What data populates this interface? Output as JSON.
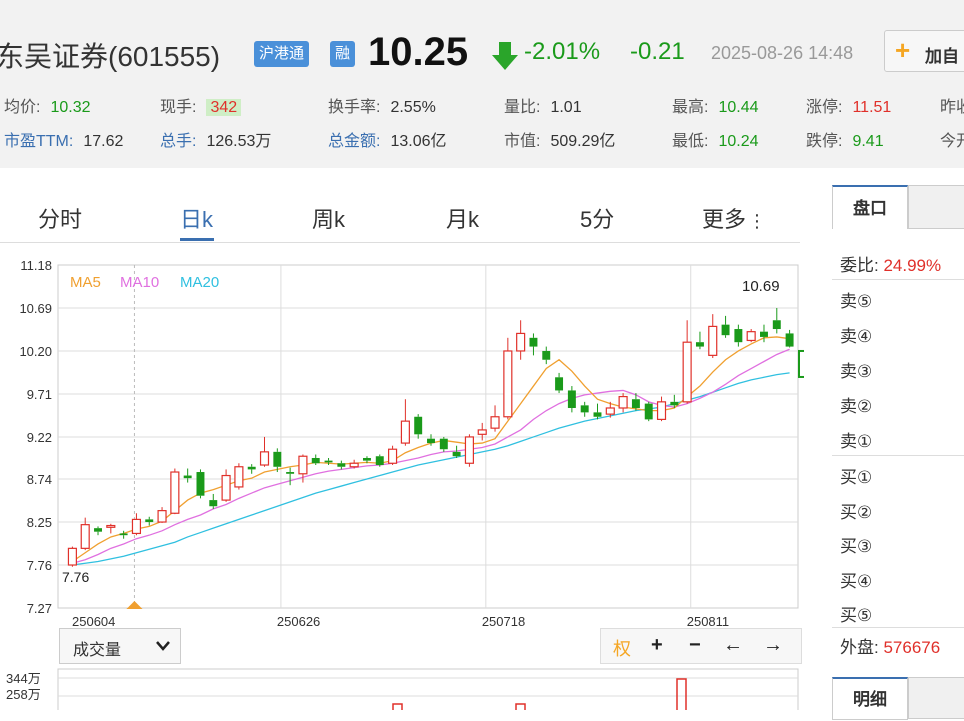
{
  "header": {
    "stock_name": "东吴证券(601555)",
    "badge_hk": "沪港通",
    "badge_margin": "融",
    "price": "10.25",
    "change_pct": "-2.01%",
    "change_abs": "-0.21",
    "datetime": "2025-08-26 14:48",
    "add_button": "加自",
    "stats_row1": [
      {
        "label": "均价:",
        "value": "10.32",
        "color": "g"
      },
      {
        "label": "现手:",
        "value": "342",
        "color": "hl"
      },
      {
        "label": "换手率:",
        "value": "2.55%",
        "color": ""
      },
      {
        "label": "量比:",
        "value": "1.01",
        "color": ""
      },
      {
        "label": "最高:",
        "value": "10.44",
        "color": "g"
      },
      {
        "label": "涨停:",
        "value": "11.51",
        "color": "r"
      },
      {
        "label": "昨收",
        "value": "",
        "color": ""
      }
    ],
    "stats_row2": [
      {
        "label": "市盈TTM:",
        "value": "17.62",
        "color": ""
      },
      {
        "label": "总手:",
        "value": "126.53万",
        "color": ""
      },
      {
        "label": "总金额:",
        "value": "13.06亿",
        "color": ""
      },
      {
        "label": "市值:",
        "value": "509.29亿",
        "color": ""
      },
      {
        "label": "最低:",
        "value": "10.24",
        "color": "g"
      },
      {
        "label": "跌停:",
        "value": "9.41",
        "color": "g"
      },
      {
        "label": "今开",
        "value": "",
        "color": ""
      }
    ]
  },
  "tabs": [
    "分时",
    "日k",
    "周k",
    "月k",
    "5分",
    "更多"
  ],
  "active_tab": "日k",
  "chart_data": {
    "type": "candlestick",
    "legend": [
      "MA5",
      "MA10",
      "MA20"
    ],
    "legend_colors": [
      "#f0a030",
      "#e070e0",
      "#30c0e0"
    ],
    "y_ticks": [
      "11.18",
      "10.69",
      "10.20",
      "9.71",
      "9.22",
      "8.74",
      "8.25",
      "7.76",
      "7.27"
    ],
    "ylim": [
      7.27,
      11.18
    ],
    "x_ticks": [
      {
        "label": "250604",
        "index": 0
      },
      {
        "label": "250626",
        "index": 16
      },
      {
        "label": "250718",
        "index": 32
      },
      {
        "label": "250811",
        "index": 48
      }
    ],
    "max_label": "10.69",
    "min_label": "7.76",
    "candles": [
      [
        7.76,
        7.95,
        7.74,
        7.97
      ],
      [
        7.95,
        8.22,
        7.93,
        8.3
      ],
      [
        8.18,
        8.14,
        8.1,
        8.2
      ],
      [
        8.19,
        8.21,
        8.12,
        8.23
      ],
      [
        8.12,
        8.1,
        8.06,
        8.15
      ],
      [
        8.12,
        8.28,
        8.1,
        8.35
      ],
      [
        8.28,
        8.25,
        8.21,
        8.31
      ],
      [
        8.25,
        8.38,
        8.24,
        8.42
      ],
      [
        8.35,
        8.82,
        8.34,
        8.86
      ],
      [
        8.78,
        8.75,
        8.7,
        8.86
      ],
      [
        8.82,
        8.55,
        8.52,
        8.85
      ],
      [
        8.5,
        8.43,
        8.4,
        8.57
      ],
      [
        8.5,
        8.78,
        8.48,
        8.85
      ],
      [
        8.65,
        8.88,
        8.62,
        8.92
      ],
      [
        8.88,
        8.85,
        8.8,
        8.91
      ],
      [
        8.9,
        9.05,
        8.88,
        9.22
      ],
      [
        9.05,
        8.88,
        8.82,
        9.09
      ],
      [
        8.82,
        8.8,
        8.67,
        8.87
      ],
      [
        8.8,
        9.0,
        8.7,
        9.02
      ],
      [
        8.98,
        8.92,
        8.9,
        9.02
      ],
      [
        8.95,
        8.93,
        8.9,
        8.98
      ],
      [
        8.92,
        8.88,
        8.85,
        8.95
      ],
      [
        8.88,
        8.92,
        8.86,
        8.96
      ],
      [
        8.98,
        8.95,
        8.92,
        9.0
      ],
      [
        9.0,
        8.9,
        8.88,
        9.02
      ],
      [
        8.92,
        9.08,
        8.9,
        9.12
      ],
      [
        9.15,
        9.4,
        9.12,
        9.65
      ],
      [
        9.45,
        9.25,
        9.2,
        9.48
      ],
      [
        9.2,
        9.15,
        9.12,
        9.25
      ],
      [
        9.2,
        9.08,
        9.05,
        9.22
      ],
      [
        9.05,
        9.0,
        8.98,
        9.12
      ],
      [
        8.92,
        9.22,
        8.88,
        9.25
      ],
      [
        9.25,
        9.3,
        9.18,
        9.38
      ],
      [
        9.32,
        9.45,
        9.28,
        9.58
      ],
      [
        9.45,
        10.2,
        9.42,
        10.35
      ],
      [
        10.2,
        10.4,
        10.1,
        10.55
      ],
      [
        10.35,
        10.25,
        10.15,
        10.4
      ],
      [
        10.2,
        10.1,
        10.05,
        10.25
      ],
      [
        9.9,
        9.75,
        9.72,
        9.95
      ],
      [
        9.75,
        9.55,
        9.5,
        9.8
      ],
      [
        9.58,
        9.5,
        9.45,
        9.62
      ],
      [
        9.5,
        9.45,
        9.42,
        9.6
      ],
      [
        9.48,
        9.55,
        9.44,
        9.62
      ],
      [
        9.55,
        9.68,
        9.5,
        9.72
      ],
      [
        9.65,
        9.55,
        9.52,
        9.72
      ],
      [
        9.6,
        9.42,
        9.4,
        9.62
      ],
      [
        9.42,
        9.62,
        9.4,
        9.68
      ],
      [
        9.62,
        9.58,
        9.55,
        9.7
      ],
      [
        9.62,
        10.3,
        9.6,
        10.55
      ],
      [
        10.3,
        10.25,
        10.22,
        10.42
      ],
      [
        10.15,
        10.48,
        10.12,
        10.62
      ],
      [
        10.5,
        10.38,
        10.35,
        10.6
      ],
      [
        10.45,
        10.3,
        10.25,
        10.5
      ],
      [
        10.32,
        10.42,
        10.3,
        10.45
      ],
      [
        10.42,
        10.36,
        10.3,
        10.5
      ],
      [
        10.55,
        10.45,
        10.4,
        10.69
      ],
      [
        10.4,
        10.25,
        10.24,
        10.44
      ]
    ],
    "ma5": [
      7.8,
      7.9,
      8.0,
      8.08,
      8.12,
      8.17,
      8.2,
      8.26,
      8.38,
      8.5,
      8.58,
      8.62,
      8.67,
      8.72,
      8.75,
      8.82,
      8.85,
      8.88,
      8.9,
      8.93,
      8.92,
      8.91,
      8.92,
      8.93,
      8.92,
      8.95,
      9.04,
      9.1,
      9.15,
      9.18,
      9.16,
      9.14,
      9.15,
      9.2,
      9.4,
      9.6,
      9.8,
      10.0,
      10.1,
      9.97,
      9.8,
      9.65,
      9.6,
      9.56,
      9.54,
      9.52,
      9.52,
      9.55,
      9.68,
      9.8,
      9.96,
      10.1,
      10.2,
      10.28,
      10.35,
      10.36,
      10.34
    ],
    "ma10": [
      7.78,
      7.82,
      7.88,
      7.95,
      8.0,
      8.06,
      8.1,
      8.15,
      8.22,
      8.28,
      8.33,
      8.4,
      8.45,
      8.52,
      8.58,
      8.64,
      8.68,
      8.72,
      8.76,
      8.8,
      8.83,
      8.85,
      8.87,
      8.89,
      8.9,
      8.92,
      8.95,
      8.98,
      9.02,
      9.05,
      9.06,
      9.08,
      9.1,
      9.14,
      9.22,
      9.3,
      9.42,
      9.52,
      9.6,
      9.66,
      9.7,
      9.72,
      9.74,
      9.75,
      9.7,
      9.62,
      9.58,
      9.56,
      9.6,
      9.66,
      9.73,
      9.82,
      9.92,
      10.0,
      10.08,
      10.16,
      10.22
    ],
    "ma20": [
      7.76,
      7.78,
      7.8,
      7.83,
      7.86,
      7.9,
      7.94,
      7.98,
      8.02,
      8.08,
      8.13,
      8.18,
      8.23,
      8.28,
      8.33,
      8.38,
      8.43,
      8.48,
      8.53,
      8.58,
      8.62,
      8.66,
      8.7,
      8.74,
      8.78,
      8.82,
      8.86,
      8.9,
      8.93,
      8.96,
      8.99,
      9.02,
      9.05,
      9.08,
      9.12,
      9.17,
      9.22,
      9.27,
      9.32,
      9.36,
      9.4,
      9.43,
      9.46,
      9.49,
      9.52,
      9.54,
      9.56,
      9.6,
      9.64,
      9.68,
      9.73,
      9.78,
      9.83,
      9.87,
      9.9,
      9.93,
      9.95
    ]
  },
  "controls": {
    "volume_select": "成交量",
    "quan": "权",
    "plus": "+",
    "minus": "−",
    "left": "←",
    "right": "→"
  },
  "volume": {
    "labels": [
      "344万",
      "258万"
    ]
  },
  "side": {
    "tab": "盘口",
    "weibi_label": "委比:",
    "weibi_value": "24.99%",
    "sells": [
      "卖⑤",
      "卖④",
      "卖③",
      "卖②",
      "卖①"
    ],
    "buys": [
      "买①",
      "买②",
      "买③",
      "买④",
      "买⑤"
    ],
    "waipan_label": "外盘:",
    "waipan_value": "576676",
    "tab2": "明细"
  }
}
